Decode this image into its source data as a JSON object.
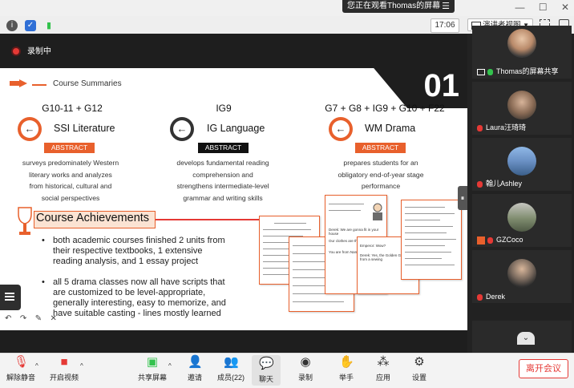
{
  "banner": {
    "text": "您正在观看Thomas的屏幕",
    "menu_icon": "menu-icon"
  },
  "toolbar": {
    "time": "17:06",
    "view_mode": "演讲者视图"
  },
  "recording": {
    "label": "录制中"
  },
  "slide": {
    "section_title": "Course Summaries",
    "number": "01",
    "courses": [
      {
        "grades": "G10-11 + G12",
        "name": "SSI Literature",
        "badge": "ABSTRACT",
        "desc": [
          "surveys predominately Western",
          "literary works and analyzes",
          "from historical, cultural and",
          "social perspectives"
        ],
        "color": "#e8602c"
      },
      {
        "grades": "IG9",
        "name": "IG Language",
        "badge": "ABSTRACT",
        "desc": [
          "develops fundamental reading",
          "comprehension and",
          "strengthens intermediate-level",
          "grammar and writing skills"
        ],
        "color": "#222222"
      },
      {
        "grades": "G7 + G8 + IG9 + G10 + F22",
        "name": "WM Drama",
        "badge": "ABSTRACT",
        "desc": [
          "prepares students for an",
          "obligatory end-of-year stage",
          "performance"
        ],
        "color": "#e8602c"
      }
    ],
    "achievements_title": "Course Achievements",
    "bullets": [
      [
        "both academic courses finished 2 units from",
        "their respective textbooks, 1 extensive",
        "reading analysis, and 1 essay project"
      ],
      [
        "all 5 drama classes now all have scripts that",
        "are customized to be level-appropriate,",
        "generally interesting, easy to memorize, and",
        "have suitable casting - lines mostly learned"
      ]
    ],
    "script_snippets": [
      "Derek: We are gonna fit in your house",
      "Our clothes are the best",
      "You are from Narnia",
      "Emperor: Wow?",
      "Derek: Yes, the Golden Gown came from a sewing"
    ]
  },
  "gallery": [
    {
      "name": "Thomas的屏幕共享",
      "mic": "green"
    },
    {
      "name": "Laura汪琦琦",
      "mic": "muted"
    },
    {
      "name": "翰儿Ashley",
      "mic": "muted"
    },
    {
      "name": "GZCoco",
      "mic": "muted"
    },
    {
      "name": "Derek",
      "mic": "muted"
    }
  ],
  "bottom": {
    "unmute": "解除静音",
    "video": "开启视频",
    "share": "共享屏幕",
    "invite": "邀请",
    "members": "成员(22)",
    "chat": "聊天",
    "record": "录制",
    "raise": "举手",
    "apps": "应用",
    "settings": "设置",
    "leave": "离开会议"
  },
  "colors": {
    "accent": "#e8602c",
    "dark": "#1e1e1e",
    "danger": "#e53935"
  }
}
